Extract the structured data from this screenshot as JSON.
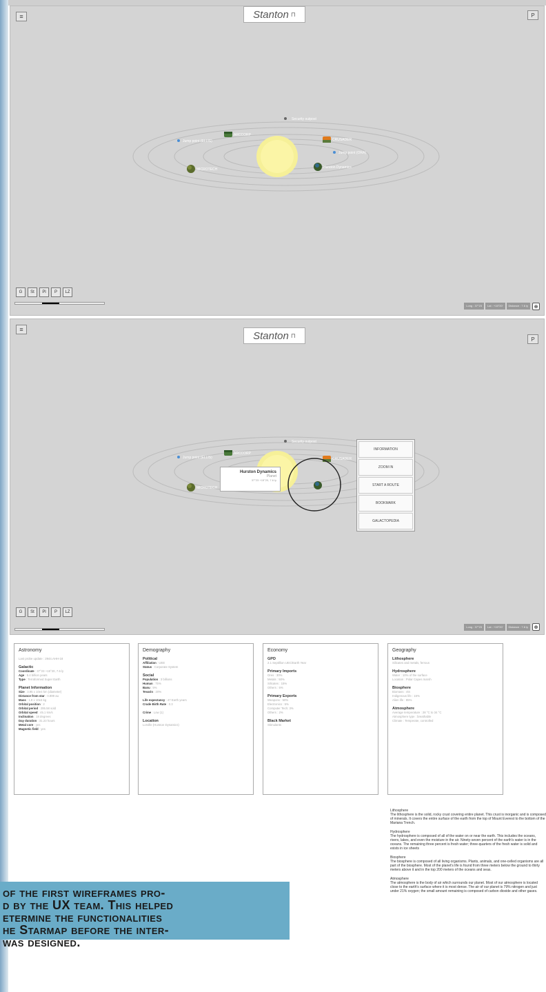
{
  "system": {
    "title": "Stanton",
    "pin_glyph": "⊓",
    "menu_glyph": "≡",
    "corner_glyph": "P"
  },
  "map": {
    "star_label": "STANTON STAR",
    "bodies": [
      "ARCCORP",
      "CRUSADER",
      "MICROTECH",
      "Hurston Dynamics"
    ],
    "stations": [
      "Security outpost",
      "Jump point (ORA)",
      "Jump point (ELLIS)"
    ]
  },
  "view_buttons": [
    "G",
    "St",
    "Pl",
    "P",
    "LZ"
  ],
  "zoom_level": 0.5,
  "coords": {
    "long": "Long : 37°23",
    "lat": "Lat : +15°20'",
    "distance": "Distance : 7.6 ly",
    "icon": "⊕"
  },
  "context_menu": [
    "INFORMATION",
    "ZOOM IN",
    "START A ROUTE",
    "BOOKMARK",
    "GALACTOPEDIA"
  ],
  "popup": {
    "name": "Hurston Dynamics",
    "type": "Planet",
    "coords": "37°23 +15°20, 7.6 ly"
  },
  "cards": {
    "astronomy": {
      "title": "Astronomy",
      "last_update": "Last probe update : 2944.AHH-18",
      "galactic_head": "Galactic",
      "galactic": [
        [
          "Coordinate",
          "37°23 +15°20, 7.6 ly"
        ],
        [
          "Age",
          "5.4 billion years"
        ],
        [
          "Type",
          "Terraformed Super Earth"
        ]
      ],
      "planet_head": "Planet Information",
      "planet": [
        [
          "Size",
          "3.95 x 10e4 km (diameter)"
        ],
        [
          "Distance from star",
          "0.899 au"
        ],
        [
          "Mass",
          "1.8 x 10e3 kg"
        ],
        [
          "Orbital position",
          "2"
        ],
        [
          "Orbital period",
          "295.58 sold"
        ],
        [
          "Orbital speed",
          "45.1 km/s"
        ],
        [
          "Inclination",
          "18 degrees"
        ],
        [
          "Day duration",
          "31.23 hours"
        ],
        [
          "Metal core",
          "yes"
        ],
        [
          "Magnetic field",
          "yes"
        ]
      ]
    },
    "demography": {
      "title": "Demography",
      "political_head": "Political",
      "political": [
        [
          "Affiliation",
          "UEE"
        ],
        [
          "Status",
          "Corporate System"
        ]
      ],
      "social_head": "Social",
      "social": [
        [
          "Population",
          "3 billions"
        ],
        [
          "Human",
          "75%"
        ],
        [
          "Banu",
          "5%"
        ],
        [
          "Tevarin",
          "20%"
        ]
      ],
      "life": [
        [
          "Life expectancy",
          "47 Earth years"
        ],
        [
          "Crude Birth Rate",
          "0.3"
        ]
      ],
      "crime": [
        [
          "Crime",
          "Low (1)"
        ]
      ],
      "location_head": "Location",
      "location": "Lorville (Hurston Dynamics)"
    },
    "economy": {
      "title": "Economy",
      "gdp_head": "GPD",
      "gdp": "2.1 Septillion UEC/Earth Year",
      "imports_head": "Primary Imports",
      "imports": [
        "Ores : 30%",
        "Metals : 50%",
        "Silicates : 15%",
        "Others : 5%"
      ],
      "exports_head": "Primary Exports",
      "exports": [
        "Weapons : 50%",
        "Electronics : 5%",
        "Computer Tech: 3%",
        "Others : 2%"
      ],
      "black_market_head": "Black Market",
      "black_market": "Stimulants"
    },
    "geography": {
      "title": "Geography",
      "litho_head": "Lithosphere",
      "litho": [
        "Silicates and metals, ferrous"
      ],
      "hydro_head": "Hydrosphere",
      "hydro": [
        "Water : 10% of the surface",
        "Location : Polar Capes marsh"
      ],
      "bio_head": "Biosphere",
      "bio": [
        "Biomass : 4tn",
        "Indigenous life : 15%",
        "Alien life : 85%"
      ],
      "atmo_head": "Atmosphere",
      "atmo": [
        "Average temperature : 28 °C to 34 °C",
        "Atmosphere type : breathable",
        "Climate : Temperate, controlled"
      ]
    }
  },
  "notes": [
    {
      "head": "Lithosphere",
      "body": "The lithosphere is the solid, rocky crust covering entire planet. This crust is inorganic and is composed of minerals. It covers the entire surface of the earth from the top of Mount Everest to the bottom of the Mariana Trench."
    },
    {
      "head": "Hydrosphere",
      "body": "The hydrosphere is composed of all of the water on or near the earth. This includes the oceans, rivers, lakes, and even the moisture in the air. Ninety-seven percent of the earth's water is in the oceans. The remaining three percent is fresh water; three-quarters of the fresh water is solid and exists in ice sheets"
    },
    {
      "head": "Biosphere",
      "body": "The biosphere is composed of all living organisms. Plants, animals, and one-celled organisms are all part of the biosphere. Most of the planet's life is found from three meters below the ground to thirty meters above it and in the top 200 meters of the oceans and seas."
    },
    {
      "head": "Atmosphere",
      "body": "The atmosphere is the body of air which surrounds our planet. Most of our atmosphere is located close to the earth's surface where it is most dense. The air of our planet is 79% nitrogen and just under 21% oxygen; the small amount remaining is composed of carbon dioxide and other gases."
    }
  ],
  "caption": {
    "line1": "of the first wireframes pro-",
    "line2": "d by the UX team. This helped",
    "line3": "etermine the functionalities",
    "line4": "he Starmap before the inter-",
    "line5": "was designed."
  }
}
